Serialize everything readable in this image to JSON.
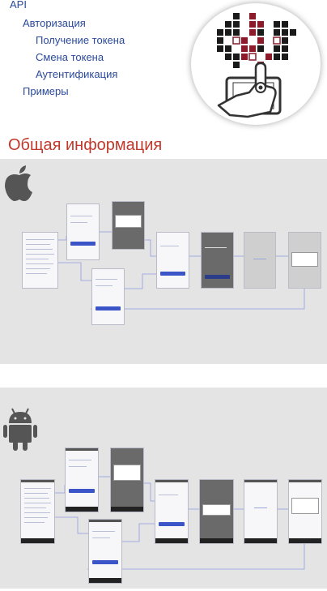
{
  "nav": {
    "api": "API",
    "auth": "Авторизация",
    "get_token": "Получение токена",
    "change_token": "Смена токена",
    "authentication": "Аутентификация",
    "examples": "Примеры"
  },
  "section_title": "Общая информация",
  "colors": {
    "link": "#2b4a9c",
    "title": "#c0392b",
    "panel_bg": "#e4e4e4",
    "accent_button": "#3b55c9",
    "logo_red": "#8b1a2b",
    "logo_dark": "#1a1a1a"
  },
  "icons": {
    "logo": "pixel-grid-hand-tablet-icon",
    "ios": "apple-icon",
    "android": "android-icon"
  },
  "flow_labels": {
    "pin_screen": "Введите PIN-код",
    "loading": "Загрузка",
    "finished": "Готово"
  }
}
